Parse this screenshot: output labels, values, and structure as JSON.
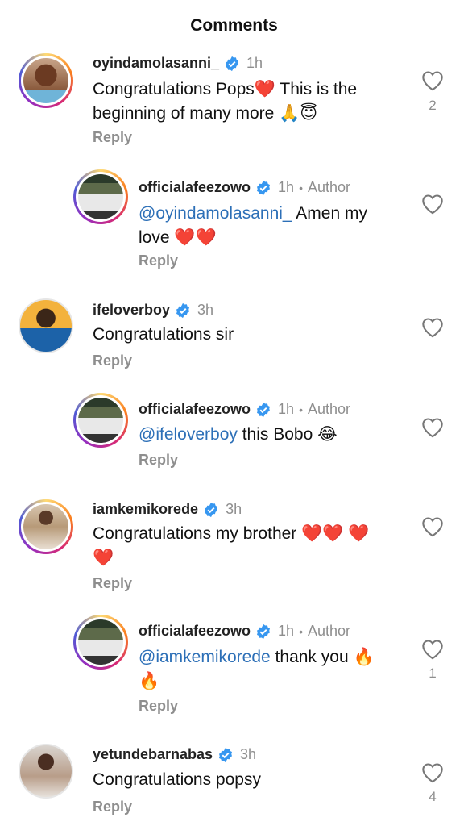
{
  "header": {
    "title": "Comments"
  },
  "comments": [
    {
      "username": "oyindamolasanni_",
      "time": "1h",
      "author": "",
      "mention": "",
      "text": "Congratulations Pops❤️ This is the beginning of many more 🙏😇",
      "reply": "Reply",
      "likes": "2"
    },
    {
      "username": "officialafeezowo",
      "time": "1h",
      "author": "Author",
      "mention": "@oyindamolasanni_",
      "text": " Amen my love ❤️❤️",
      "reply": "Reply",
      "likes": ""
    },
    {
      "username": "ifeloverboy",
      "time": "3h",
      "author": "",
      "mention": "",
      "text": "Congratulations sir",
      "reply": "Reply",
      "likes": ""
    },
    {
      "username": "officialafeezowo",
      "time": "1h",
      "author": "Author",
      "mention": "@ifeloverboy",
      "text": " this Bobo 😂",
      "reply": "Reply",
      "likes": ""
    },
    {
      "username": "iamkemikorede",
      "time": "3h",
      "author": "",
      "mention": "",
      "text": "Congratulations my brother ❤️❤️ ❤️❤️",
      "reply": "Reply",
      "likes": ""
    },
    {
      "username": "officialafeezowo",
      "time": "1h",
      "author": "Author",
      "mention": "@iamkemikorede",
      "text": " thank you 🔥🔥",
      "reply": "Reply",
      "likes": "1"
    },
    {
      "username": "yetundebarnabas",
      "time": "3h",
      "author": "",
      "mention": "",
      "text": "Congratulations popsy",
      "reply": "Reply",
      "likes": "4"
    }
  ],
  "colors": {
    "verified": "#3797f0",
    "mention": "#2c6fb7",
    "muted": "#8e8e8e"
  },
  "icons": {
    "verified": "verified-badge-icon",
    "like": "heart-outline-icon"
  }
}
